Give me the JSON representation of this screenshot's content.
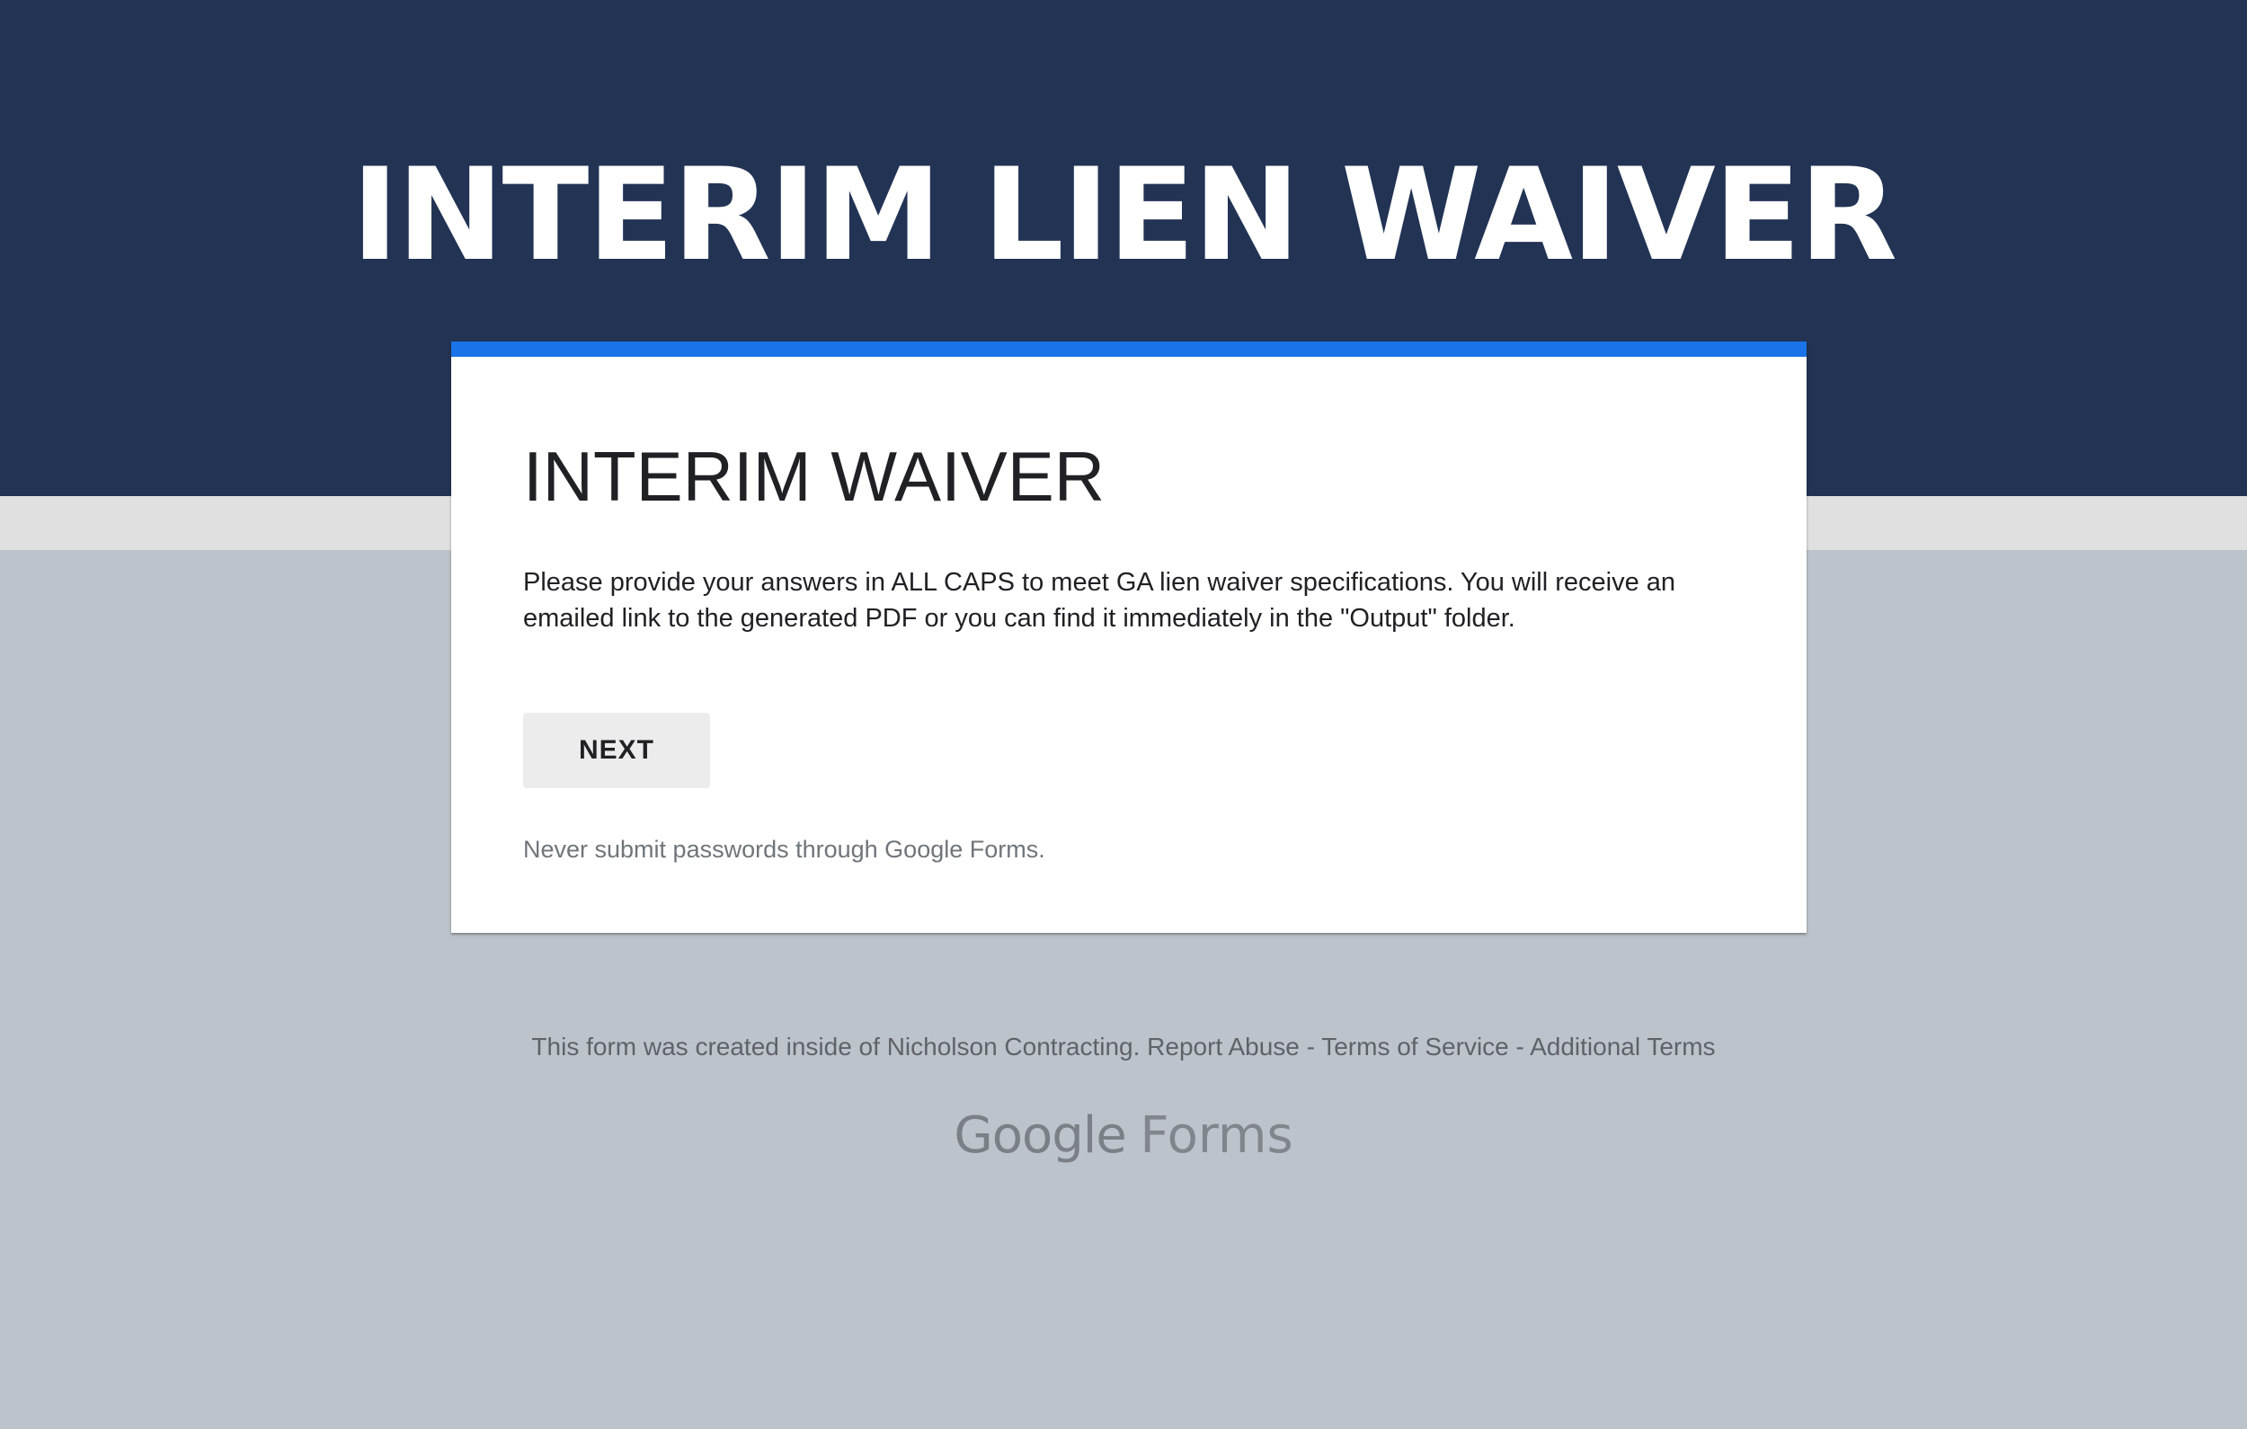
{
  "banner": {
    "title": "INTERIM LIEN WAIVER"
  },
  "form": {
    "title": "INTERIM WAIVER",
    "description": "Please provide your answers in ALL CAPS to meet GA lien waiver specifications. You will receive an emailed link to the generated PDF or you can find it immediately in the \"Output\" folder.",
    "next_label": "NEXT",
    "password_warning": "Never submit passwords through Google Forms."
  },
  "footer": {
    "created_text": "This form was created inside of Nicholson Contracting.",
    "report_abuse": "Report Abuse",
    "terms_of_service": "Terms of Service",
    "additional_terms": "Additional Terms",
    "separator": "-"
  },
  "brand": {
    "google": "Google",
    "forms": "Forms"
  },
  "colors": {
    "header_background": "#223354",
    "page_background": "#bdc3cb",
    "accent": "#1a73e8",
    "card_background": "#ffffff",
    "button_background": "#ececec"
  }
}
